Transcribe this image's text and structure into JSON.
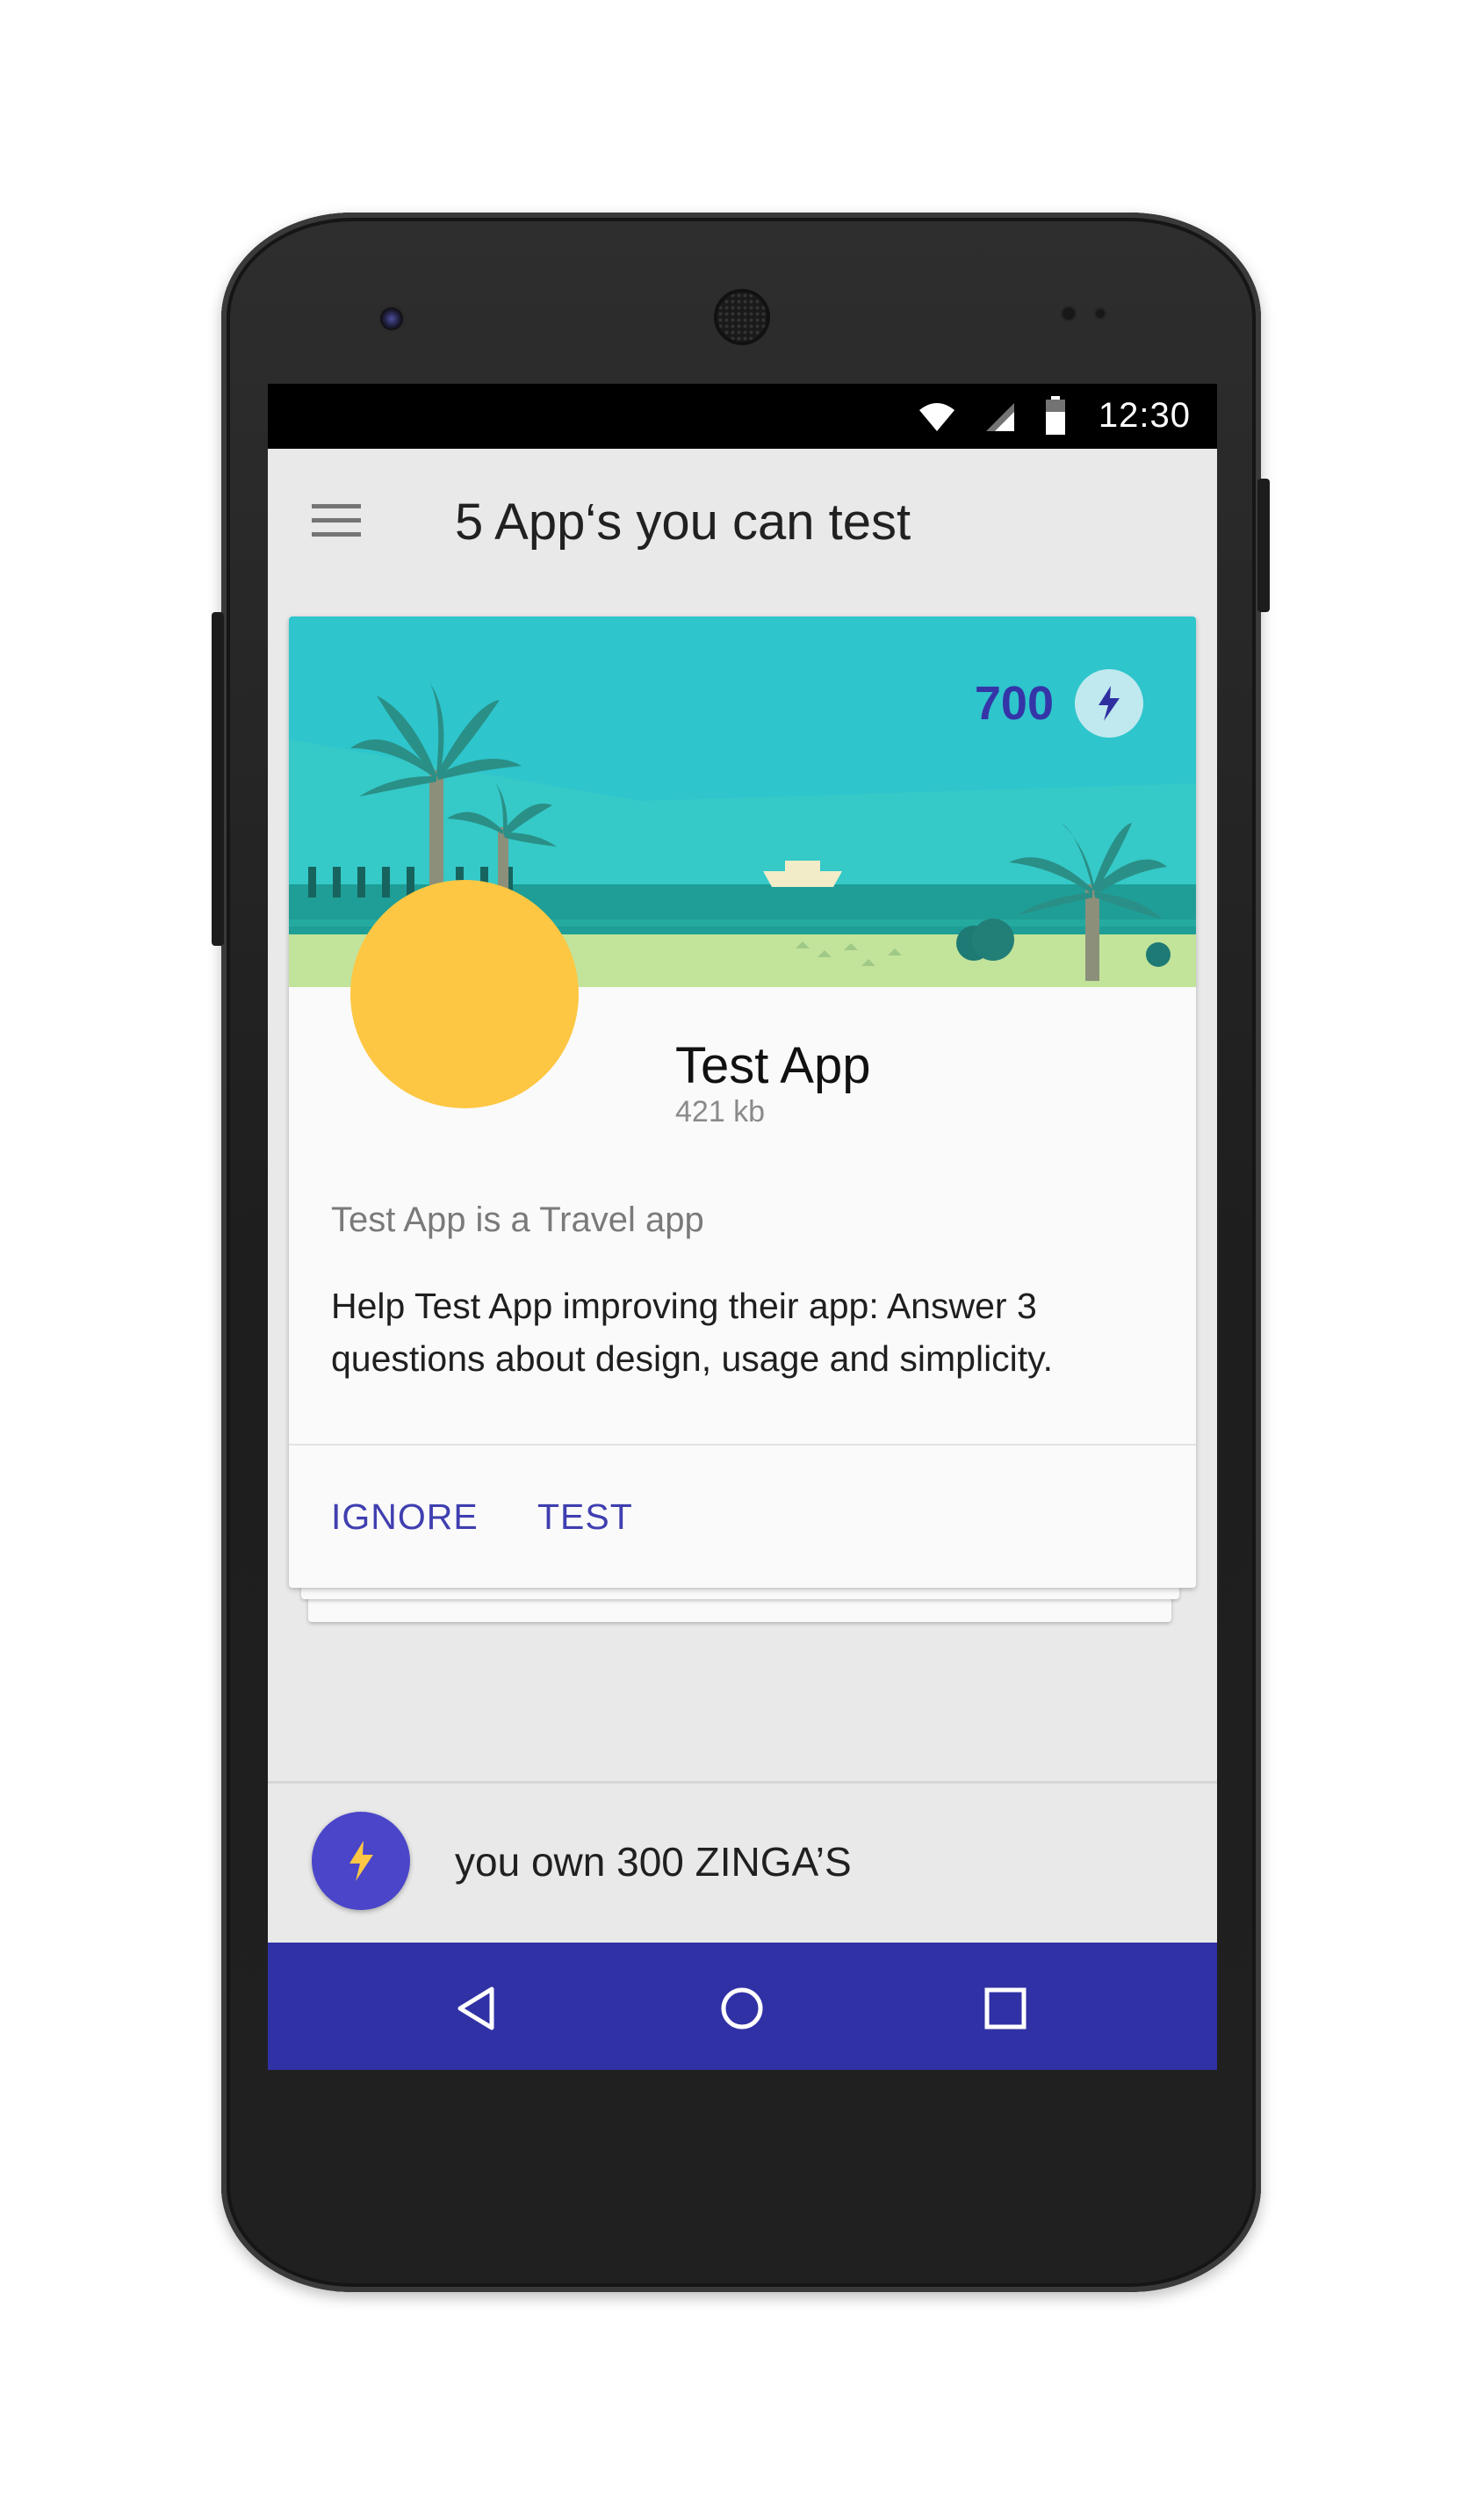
{
  "status_bar": {
    "time": "12:30",
    "icons": [
      "wifi-icon",
      "signal-icon",
      "battery-icon"
    ]
  },
  "app_bar": {
    "title": "5 App‘s you can test",
    "menu_icon": "menu-icon"
  },
  "card": {
    "points": "700",
    "points_icon": "bolt-icon",
    "app_name": "Test App",
    "app_size": "421 kb",
    "category_text": "Test App is a Travel app",
    "description": "Help Test App improving their app: Answer 3 questions about design, usage and simplicity.",
    "actions": {
      "ignore": "IGNORE",
      "test": "TEST"
    },
    "avatar_color": "#fdc743"
  },
  "bottom_bar": {
    "text": "you own 300 ZINGA’S",
    "icon": "bolt-icon"
  },
  "nav_bar": {
    "buttons": [
      "back-icon",
      "home-icon",
      "recents-icon"
    ]
  },
  "colors": {
    "primary": "#3131a6",
    "accent": "#3f3fb0",
    "fab": "#4a45c9",
    "sky": "#2ec5cc",
    "sea": "#1e9e96",
    "sand": "#c2e39a",
    "avatar": "#fdc743"
  }
}
